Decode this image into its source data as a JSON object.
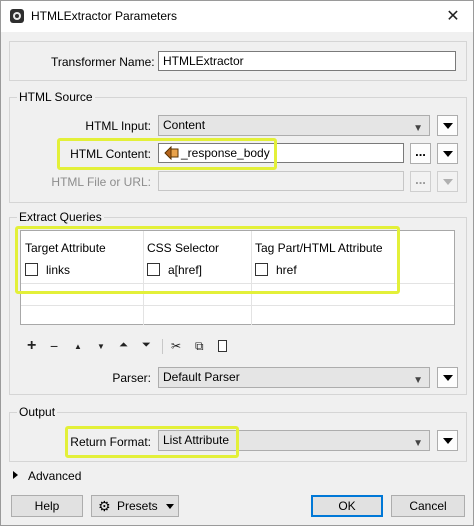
{
  "window": {
    "title": "HTMLExtractor Parameters",
    "close_glyph": "✕"
  },
  "transformer_name": {
    "label": "Transformer Name:",
    "value": "HTMLExtractor"
  },
  "html_source": {
    "title": "HTML Source",
    "html_input": {
      "label": "HTML Input:",
      "value": "Content"
    },
    "html_content": {
      "label": "HTML Content:",
      "value": "_response_body",
      "icon": "attribute-icon",
      "more_glyph": "..."
    },
    "html_file": {
      "label": "HTML File or URL:",
      "value": "",
      "more_glyph": "..."
    }
  },
  "extract_queries": {
    "title": "Extract Queries",
    "columns": [
      "Target Attribute",
      "CSS Selector",
      "Tag Part/HTML Attribute"
    ],
    "rows": [
      {
        "target_attribute": "links",
        "css_selector": "a[href]",
        "tag_part": "href"
      }
    ],
    "toolbar": {
      "add": "+",
      "remove": "−",
      "move_up": "▲",
      "move_down": "▼",
      "move_top": "⏶",
      "move_bottom": "⏷",
      "cut": "✂",
      "copy": "⧉",
      "paste": "📋"
    },
    "parser": {
      "label": "Parser:",
      "value": "Default Parser"
    }
  },
  "output": {
    "title": "Output",
    "return_format": {
      "label": "Return Format:",
      "value": "List Attribute"
    }
  },
  "advanced": {
    "label": "Advanced"
  },
  "buttons": {
    "help": "Help",
    "presets": "Presets",
    "ok": "OK",
    "cancel": "Cancel"
  },
  "colors": {
    "highlight": "#e3f039",
    "focus_blue": "#0078d7"
  }
}
